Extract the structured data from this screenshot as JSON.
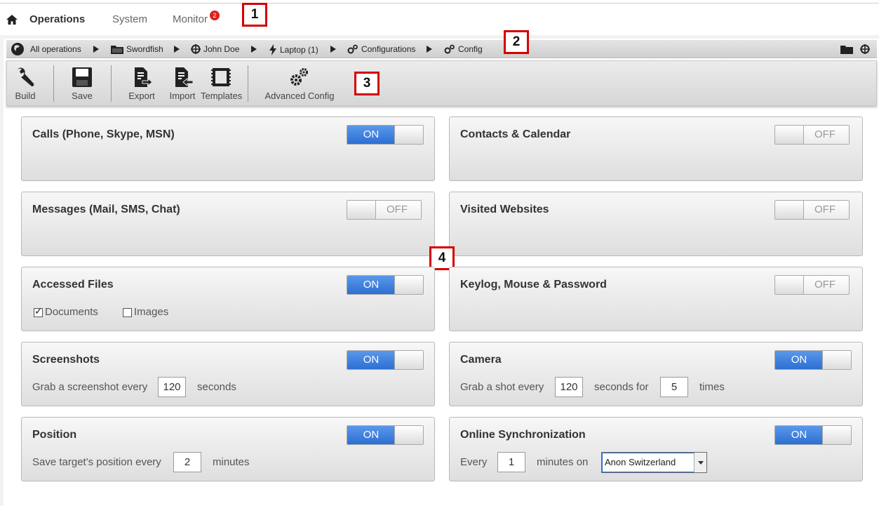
{
  "topnav": {
    "tabs": [
      {
        "label": "Operations",
        "active": true
      },
      {
        "label": "System",
        "active": false
      },
      {
        "label": "Monitor",
        "active": false
      }
    ],
    "monitor_badge": "2"
  },
  "callouts": [
    "1",
    "2",
    "3",
    "4"
  ],
  "breadcrumb": [
    {
      "label": "All operations",
      "icon": "globe-icon"
    },
    {
      "label": "Swordfish",
      "icon": "folder-icon"
    },
    {
      "label": "John Doe",
      "icon": "target-icon"
    },
    {
      "label": "Laptop (1)",
      "icon": "lightning-icon"
    },
    {
      "label": "Configurations",
      "icon": "gears-icon"
    },
    {
      "label": "Config",
      "icon": "gears-icon"
    }
  ],
  "toolbar": {
    "build": "Build",
    "save": "Save",
    "export": "Export",
    "import": "Import",
    "templates": "Templates",
    "advanced": "Advanced Config"
  },
  "toggle_labels": {
    "on": "ON",
    "off": "OFF"
  },
  "panels": {
    "calls": {
      "title": "Calls (Phone, Skype, MSN)",
      "enabled": true
    },
    "contacts": {
      "title": "Contacts & Calendar",
      "enabled": false
    },
    "messages": {
      "title": "Messages (Mail, SMS, Chat)",
      "enabled": false
    },
    "websites": {
      "title": "Visited Websites",
      "enabled": false
    },
    "files": {
      "title": "Accessed Files",
      "enabled": true,
      "documents_label": "Documents",
      "documents_checked": true,
      "images_label": "Images",
      "images_checked": false
    },
    "keylog": {
      "title": "Keylog, Mouse & Password",
      "enabled": false
    },
    "screenshots": {
      "title": "Screenshots",
      "enabled": true,
      "prefix": "Grab a screenshot every",
      "interval": "120",
      "suffix": "seconds"
    },
    "camera": {
      "title": "Camera",
      "enabled": true,
      "prefix": "Grab a shot every",
      "interval": "120",
      "middle": "seconds for",
      "count": "5",
      "suffix": "times"
    },
    "position": {
      "title": "Position",
      "enabled": true,
      "prefix": "Save target's position every",
      "interval": "2",
      "suffix": "minutes"
    },
    "sync": {
      "title": "Online Synchronization",
      "enabled": true,
      "prefix": "Every",
      "interval": "1",
      "middle": "minutes on",
      "server": "Anon Switzerland"
    }
  }
}
